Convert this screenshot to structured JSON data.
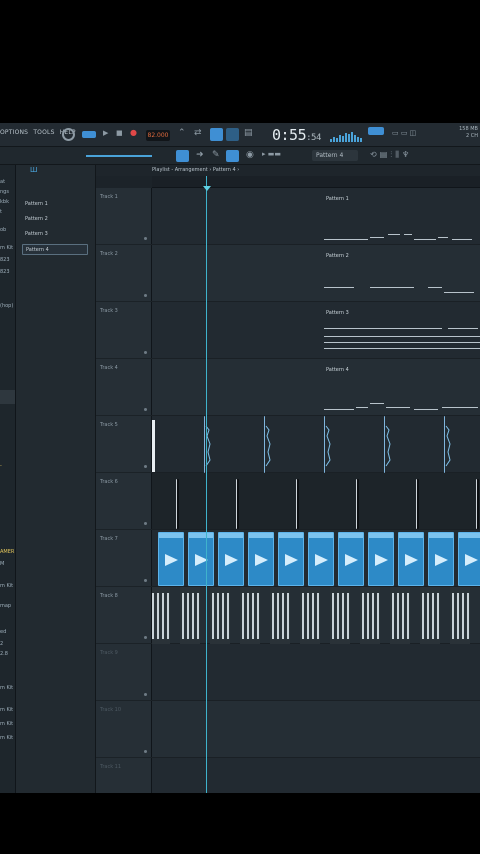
{
  "menu": {
    "items": [
      "OPTIONS",
      "TOOLS",
      "HELP"
    ]
  },
  "transport": {
    "tempo": "82.000",
    "time_main": "0:55",
    "time_ms": ":54"
  },
  "cpu": {
    "readout_top": "158 MB",
    "readout_bottom": "2 CH"
  },
  "toolbar2": {
    "pattern_selector": "Pattern 4"
  },
  "playlist": {
    "breadcrumb": "Playlist - Arrangement › Pattern 4 ›"
  },
  "browser": {
    "items": [
      "at",
      "ngs",
      "kbk",
      "t",
      "ob",
      "m Kit",
      "823",
      "823",
      "(hop)",
      "-",
      "AMER",
      "M",
      "m Kit",
      "map",
      "ed",
      "2",
      "2.8",
      "m Kit",
      "m Kit",
      "m Kit",
      "m Kit"
    ]
  },
  "picker": {
    "items": [
      "Pattern 1",
      "Pattern 2",
      "Pattern 3",
      "Pattern 4"
    ],
    "selected_index": 3
  },
  "tracks": [
    {
      "name": "Track 1",
      "pattern": "Pattern 1"
    },
    {
      "name": "Track 2",
      "pattern": "Pattern 2"
    },
    {
      "name": "Track 3",
      "pattern": "Pattern 3"
    },
    {
      "name": "Track 4",
      "pattern": "Pattern 4"
    },
    {
      "name": "Track 5",
      "pattern": ""
    },
    {
      "name": "Track 6",
      "pattern": ""
    },
    {
      "name": "Track 7",
      "pattern": ""
    },
    {
      "name": "Track 8",
      "pattern": ""
    },
    {
      "name": "Track 9",
      "pattern": ""
    },
    {
      "name": "Track 10",
      "pattern": ""
    },
    {
      "name": "Track 11",
      "pattern": ""
    }
  ],
  "colors": {
    "accent": "#3f8fd4",
    "playhead": "#3fb3cc",
    "clip_blue": "#2d8ac7",
    "tempo": "#e06a3d"
  }
}
